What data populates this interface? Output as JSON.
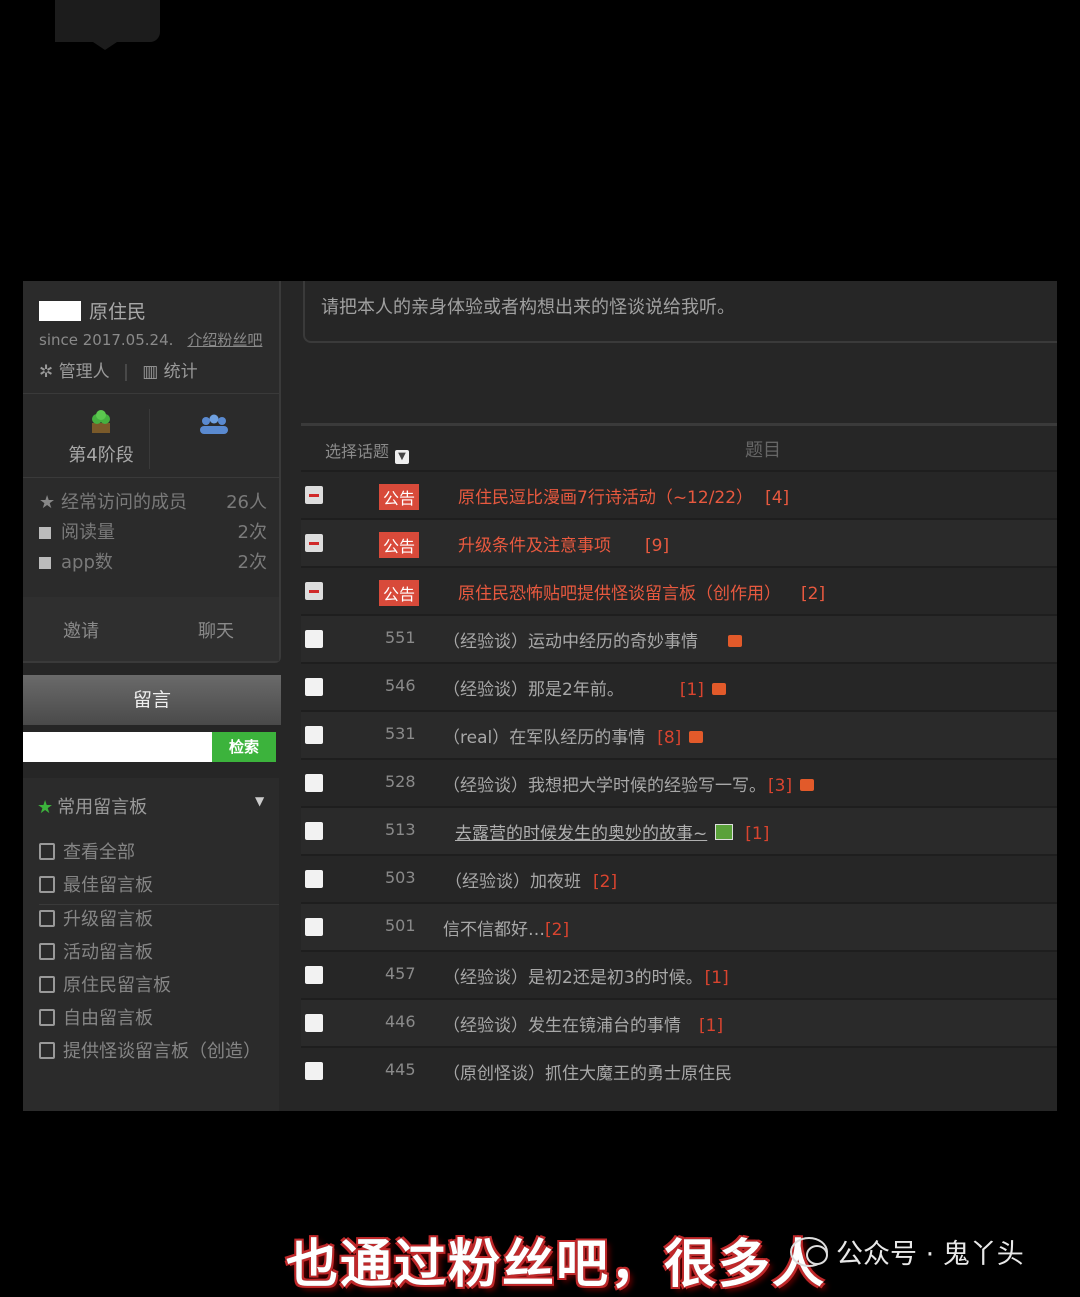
{
  "profile": {
    "name": "原住民",
    "since": "since 2017.05.24.",
    "intro_link": "介绍粉丝吧",
    "admin": "管理人",
    "stats_label": "统计",
    "stage": "第4阶段",
    "stats": [
      {
        "label": "经常访问的成员",
        "value": "26人"
      },
      {
        "label": "阅读量",
        "value": "2次"
      },
      {
        "label": "app数",
        "value": "2次"
      }
    ],
    "invite": "邀请",
    "chat": "聊天"
  },
  "sidebar": {
    "message_button": "留言",
    "search_button": "检索",
    "search_value": "",
    "favorites_label": "常用留言板",
    "boards": [
      "查看全部",
      "最佳留言板",
      "升级留言板",
      "活动留言板",
      "原住民留言板",
      "自由留言板",
      "提供怪谈留言板（创造）"
    ]
  },
  "notice_text": "请把本人的亲身体验或者构想出来的怪谈说给我听。",
  "table": {
    "select_label": "选择话题",
    "title_header": "题目",
    "notices": [
      {
        "badge": "公告",
        "title": "原住民逗比漫画7行诗活动（~12/22）",
        "count": "[4]"
      },
      {
        "badge": "公告",
        "title": "升级条件及注意事项",
        "count": "[9]"
      },
      {
        "badge": "公告",
        "title": "原住民恐怖贴吧提供怪谈留言板（创作用）",
        "count": "[2]"
      }
    ],
    "posts": [
      {
        "num": "551",
        "title": "（经验谈）运动中经历的奇妙事情",
        "count": ""
      },
      {
        "num": "546",
        "title": "（经验谈）那是2年前。",
        "count": "[1]"
      },
      {
        "num": "531",
        "title": "（real）在军队经历的事情",
        "count": "[8]"
      },
      {
        "num": "528",
        "title": "（经验谈）我想把大学时候的经验写一写。",
        "count": "[3]"
      },
      {
        "num": "513",
        "title": "去露营的时候发生的奥妙的故事~",
        "count": "[1]"
      },
      {
        "num": "503",
        "title": "（经验谈）加夜班",
        "count": "[2]"
      },
      {
        "num": "501",
        "title": "信不信都好…",
        "count": "[2]"
      },
      {
        "num": "457",
        "title": "（经验谈）是初2还是初3的时候。",
        "count": "[1]"
      },
      {
        "num": "446",
        "title": "（经验谈）发生在镜浦台的事情",
        "count": "[1]"
      },
      {
        "num": "445",
        "title": "（原创怪谈）抓住大魔王的勇士原住民",
        "count": ""
      }
    ]
  },
  "caption": "也通过粉丝吧，很多人",
  "watermark": "公众号 · 鬼丫头",
  "colors": {
    "accent_red": "#e8593f",
    "badge_red": "#d84a3a",
    "green": "#3cb33c"
  }
}
